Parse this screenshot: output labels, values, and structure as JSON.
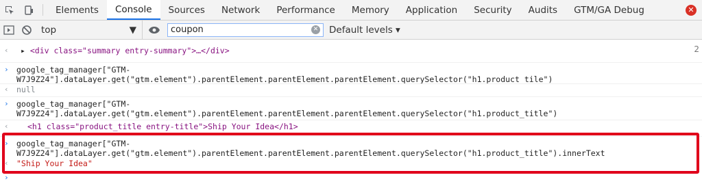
{
  "tabs": [
    "Elements",
    "Console",
    "Sources",
    "Network",
    "Performance",
    "Memory",
    "Application",
    "Security",
    "Audits",
    "GTM/GA Debug"
  ],
  "active_tab": "Console",
  "toolbar": {
    "context": "top",
    "filter_value": "coupon",
    "levels_label": "Default levels ▾",
    "right_count": "2"
  },
  "console": {
    "line1": "<div class=\"summary entry-summary\">…</div>",
    "cmd1_a": "google_tag_manager[\"GTM-",
    "cmd1_b": "W7J9Z24\"].dataLayer.get(\"gtm.element\").parentElement.parentElement.parentElement.querySelector(\"h1.product_tile\")",
    "res1": "null",
    "cmd2_a": "google_tag_manager[\"GTM-",
    "cmd2_b": "W7J9Z24\"].dataLayer.get(\"gtm.element\").parentElement.parentElement.parentElement.querySelector(\"h1.product_title\")",
    "res2": "<h1 class=\"product_title entry-title\">Ship Your Idea</h1>",
    "cmd3_a": "google_tag_manager[\"GTM-",
    "cmd3_b": "W7J9Z24\"].dataLayer.get(\"gtm.element\").parentElement.parentElement.parentElement.querySelector(\"h1.product_title\").innerText",
    "res3": "\"Ship Your Idea\""
  },
  "colors": {
    "highlight": "#e0001b",
    "active_tab_underline": "#1a73e8"
  }
}
